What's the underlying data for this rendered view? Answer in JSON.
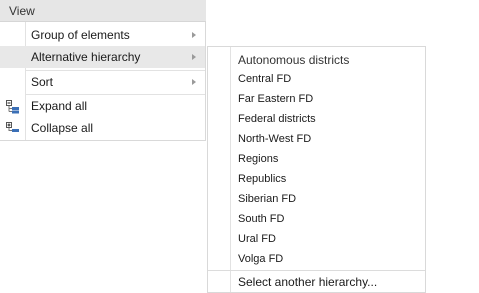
{
  "header": {
    "title": "View"
  },
  "menu": {
    "group_of_elements": "Group of elements",
    "alternative_hierarchy": "Alternative hierarchy",
    "sort": "Sort",
    "expand_all": "Expand all",
    "collapse_all": "Collapse all"
  },
  "icons": {
    "expand_all": "expand-tree-icon",
    "collapse_all": "collapse-tree-icon",
    "submenu_arrow": "chevron-right-icon"
  },
  "submenu": {
    "title": "Autonomous districts",
    "items": [
      "Central FD",
      "Far Eastern FD",
      "Federal districts",
      "North-West FD",
      "Regions",
      "Republics",
      "Siberian FD",
      "South FD",
      "Ural FD",
      "Volga FD"
    ],
    "footer": "Select another hierarchy..."
  },
  "colors": {
    "header_bg": "#e6e6e6",
    "highlight_bg": "#e8e8e8",
    "icon_blue": "#3b6fb6"
  }
}
